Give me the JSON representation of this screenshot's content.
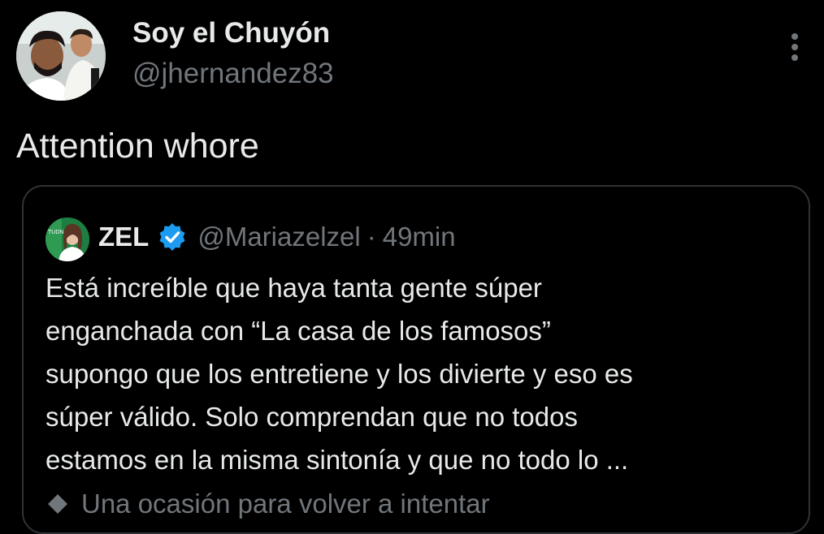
{
  "author": {
    "display_name": "Soy el Chuyón",
    "handle": "@jhernandez83",
    "avatar_icon": "profile-photo-avatar"
  },
  "tweet": {
    "text": "Attention whore",
    "more_icon": "more-vertical-icon"
  },
  "quoted_tweet": {
    "name": "ZEL",
    "verified_icon": "verified-badge-icon",
    "verified_color": "#1d9bf0",
    "handle": "@Mariazelzel",
    "separator": "·",
    "time": "49min",
    "lines": [
      "Está increíble que haya tanta gente súper",
      "enganchada con “La casa de los famosos”",
      "supongo que los entretiene y los divierte y eso es",
      "súper válido. Solo comprendan que no todos",
      "estamos en la misma sintonía y que no todo lo ..."
    ],
    "footer_text": "Una ocasión para volver a intentar",
    "footer_icon": "diamond-icon"
  },
  "colors": {
    "background": "#000000",
    "primary_text": "#e7e9ea",
    "secondary_text": "#71767b",
    "border": "#2f3336"
  }
}
